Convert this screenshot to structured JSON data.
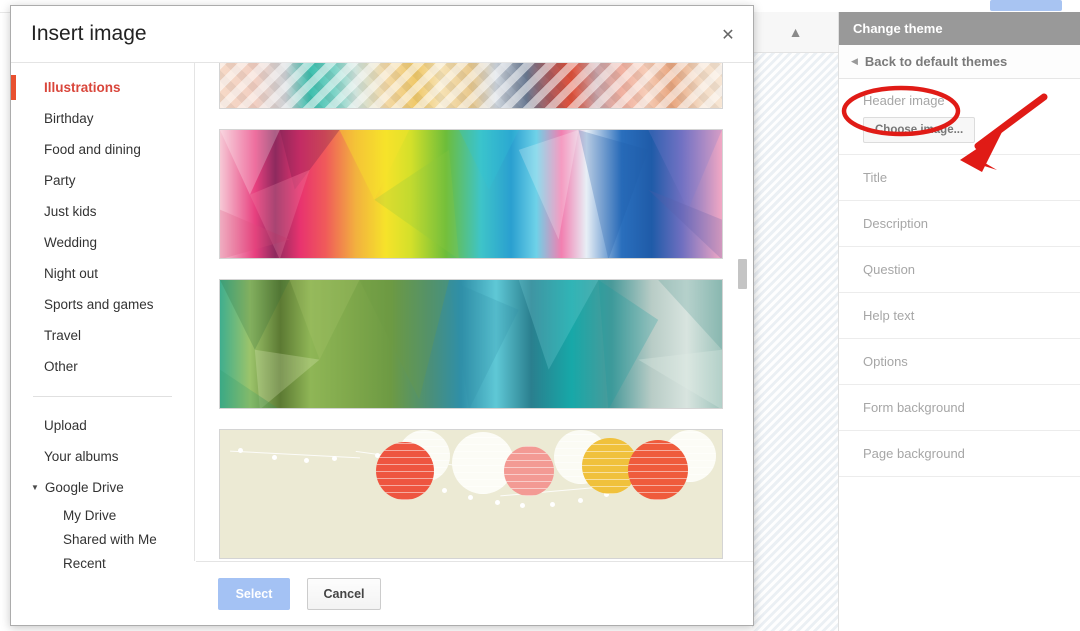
{
  "background": {
    "collapse_icon": "chevron-double-up-icon",
    "top_button_label": ""
  },
  "dialog": {
    "title": "Insert image",
    "close_icon": "close-icon",
    "sidebar": {
      "categories": [
        {
          "label": "Illustrations",
          "active": true
        },
        {
          "label": "Birthday",
          "active": false
        },
        {
          "label": "Food and dining",
          "active": false
        },
        {
          "label": "Party",
          "active": false
        },
        {
          "label": "Just kids",
          "active": false
        },
        {
          "label": "Wedding",
          "active": false
        },
        {
          "label": "Night out",
          "active": false
        },
        {
          "label": "Sports and games",
          "active": false
        },
        {
          "label": "Travel",
          "active": false
        },
        {
          "label": "Other",
          "active": false
        }
      ],
      "sources": [
        {
          "label": "Upload"
        },
        {
          "label": "Your albums"
        }
      ],
      "drive": {
        "label": "Google Drive",
        "expanded": true,
        "caret_icon": "caret-down-icon",
        "children": [
          {
            "label": "My Drive"
          },
          {
            "label": "Shared with Me"
          },
          {
            "label": "Recent"
          }
        ]
      }
    },
    "thumbnails": [
      {
        "name": "pastel-diamond-mosaic",
        "alt": "Pastel diamond mosaic banner"
      },
      {
        "name": "rainbow-low-poly",
        "alt": "Rainbow low-poly triangles banner"
      },
      {
        "name": "green-teal-low-poly",
        "alt": "Green and teal low-poly banner"
      },
      {
        "name": "paper-lanterns",
        "alt": "Paper lanterns on string lights banner"
      }
    ],
    "footer": {
      "select_label": "Select",
      "select_disabled": true,
      "cancel_label": "Cancel"
    }
  },
  "theme_panel": {
    "header_title": "Change theme",
    "back_label": "Back to default themes",
    "back_caret_icon": "caret-left-icon",
    "header_image": {
      "label": "Header image",
      "button_label": "Choose image..."
    },
    "rows": [
      {
        "label": "Title"
      },
      {
        "label": "Description"
      },
      {
        "label": "Question"
      },
      {
        "label": "Help text"
      },
      {
        "label": "Options"
      },
      {
        "label": "Form background"
      },
      {
        "label": "Page background"
      }
    ]
  },
  "annotations": {
    "ellipse_target": "Header image",
    "arrow_target": "Choose image...",
    "color": "#e01b16"
  },
  "colors": {
    "accent_red": "#d9463b",
    "panel_header_gray": "#999999",
    "select_button_blue": "#a4c2f4",
    "annotation_red": "#e01b16"
  }
}
